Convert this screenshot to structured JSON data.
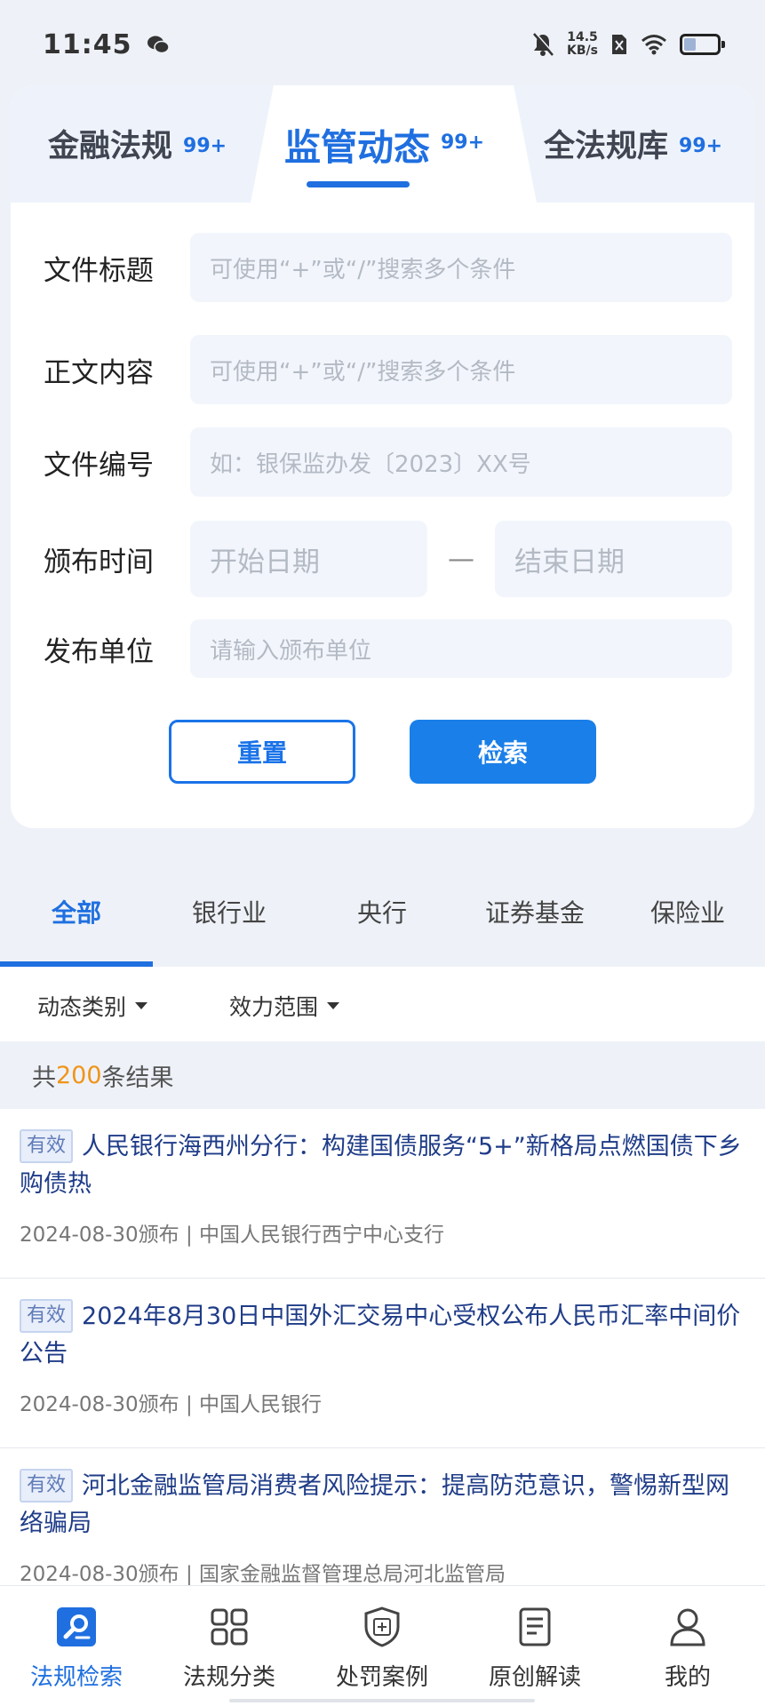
{
  "status": {
    "time": "11:45",
    "speed_value": "14.5",
    "speed_unit": "KB/s",
    "icons": [
      "wechat-icon",
      "mute-bell-icon",
      "sim-blocked-icon",
      "wifi-icon",
      "battery-icon"
    ],
    "battery_level": 0.35
  },
  "search_tabs": [
    {
      "label": "金融法规",
      "count": "99+"
    },
    {
      "label": "监管动态",
      "count": "99+",
      "active": true
    },
    {
      "label": "全法规库",
      "count": "99+"
    }
  ],
  "form": {
    "title_label": "文件标题",
    "title_placeholder": "可使用“+”或“/”搜索多个条件",
    "content_label": "正文内容",
    "content_placeholder": "可使用“+”或“/”搜索多个条件",
    "number_label": "文件编号",
    "number_placeholder": "如：银保监办发〔2023〕XX号",
    "date_label": "颁布时间",
    "start_placeholder": "开始日期",
    "date_separator": "—",
    "end_placeholder": "结束日期",
    "unit_label": "发布单位",
    "unit_placeholder": "请输入颁布单位",
    "reset_label": "重置",
    "search_label": "检索"
  },
  "categories": [
    "全部",
    "银行业",
    "央行",
    "证券基金",
    "保险业"
  ],
  "filters": {
    "type_label": "动态类别",
    "scope_label": "效力范围"
  },
  "count": {
    "prefix": "共",
    "number": "200",
    "suffix": "条结果"
  },
  "results": [
    {
      "badge": "有效",
      "title": "人民银行海西州分行：构建国债服务“5+”新格局点燃国债下乡购债热",
      "meta": "2024-08-30颁布 | 中国人民银行西宁中心支行"
    },
    {
      "badge": "有效",
      "title": "2024年8月30日中国外汇交易中心受权公布人民币汇率中间价公告",
      "meta": "2024-08-30颁布 | 中国人民银行"
    },
    {
      "badge": "有效",
      "title": "河北金融监管局消费者风险提示：提高防范意识，警惕新型网络骗局",
      "meta": "2024-08-30颁布 | 国家金融监督管理总局河北监管局"
    }
  ],
  "nav": [
    {
      "label": "法规检索",
      "icon": "law-search-icon",
      "active": true
    },
    {
      "label": "法规分类",
      "icon": "grid-category-icon"
    },
    {
      "label": "处罚案例",
      "icon": "penalty-shield-icon"
    },
    {
      "label": "原创解读",
      "icon": "document-icon"
    },
    {
      "label": "我的",
      "icon": "user-icon"
    }
  ],
  "colors": {
    "accent": "#1f6fe0",
    "button": "#1a7fe8",
    "count_highlight": "#f0941a",
    "title_text": "#1f3c88",
    "page_bg": "#eef2f8"
  }
}
